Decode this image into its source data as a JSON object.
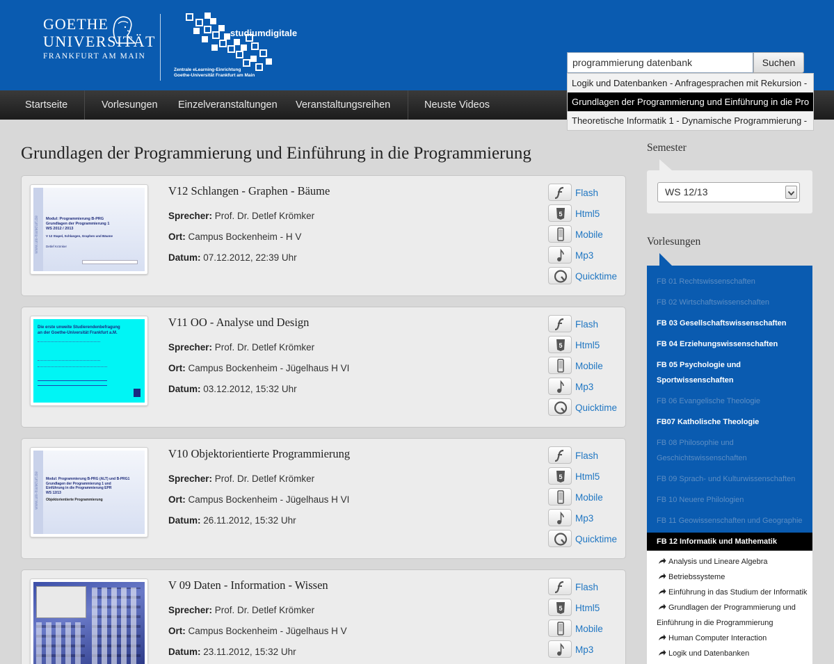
{
  "header": {
    "goethe_line1": "GOETHE",
    "goethe_line2": "UNIVERSITÄT",
    "goethe_line3": "FRANKFURT AM MAIN",
    "studium_title": "studiumdigitale",
    "studium_sub1": "Zentrale eLearning-Einrichtung",
    "studium_sub2": "Goethe-Universität Frankfurt am Main"
  },
  "search": {
    "value": "programmierung datenbank",
    "button_label": "Suchen",
    "suggestions": [
      "Logik und Datenbanken - Anfragesprachen mit Rekursion -",
      "Grundlagen der Programmierung und Einführung in die Pro",
      "Theoretische Informatik 1 - Dynamische Programmierung -"
    ],
    "active_index": 1
  },
  "nav": [
    "Startseite",
    "Vorlesungen",
    "Einzelveranstaltungen",
    "Veranstaltungsreihen",
    "Neuste Videos"
  ],
  "main": {
    "title": "Grundlagen der Programmierung und Einführung in die Programmierung",
    "speaker_label": "Sprecher:",
    "place_label": "Ort:",
    "date_label": "Datum:",
    "formats": [
      "Flash",
      "Html5",
      "Mobile",
      "Mp3",
      "Quicktime"
    ],
    "lectures": [
      {
        "title": "V12 Schlangen - Graphen - Bäume",
        "speaker": "Prof. Dr. Detlef Krömker",
        "place": "Campus Bockenheim - H V",
        "date": "07.12.2012, 22:39 Uhr"
      },
      {
        "title": "V11 OO - Analyse und Design",
        "speaker": "Prof. Dr. Detlef Krömker",
        "place": "Campus Bockenheim - Jügelhaus H VI",
        "date": "03.12.2012, 15:32 Uhr"
      },
      {
        "title": "V10 Objektorientierte Programmierung",
        "speaker": "Prof. Dr. Detlef Krömker",
        "place": "Campus Bockenheim - Jügelhaus H VI",
        "date": "26.11.2012, 15:32 Uhr"
      },
      {
        "title": "V 09 Daten - Information - Wissen",
        "speaker": "Prof. Dr. Detlef Krömker",
        "place": "Campus Bockenheim - Jügelhaus H V",
        "date": "23.11.2012, 15:32 Uhr"
      }
    ],
    "thumbs": {
      "t1_l1": "Modul: Programmierung B-PRG",
      "t1_l2": "Grundlagen der Programmierung 1",
      "t1_l3": "WS 2012 / 2013",
      "t1_l4": "V 12 Stapel, Schlangen, Graphen und Bäume",
      "t1_l5": "Detlef Krömker",
      "t2_l1": "Die erste unweite Studierendenbefragung",
      "t2_l2": "an der Goethe-Universität Frankfurt a.M.",
      "t3_l1": "Modul: Programmierung B-PRG (ALT) und B-PRG1",
      "t3_l2": "Grundlagen der Programmierung 1 und",
      "t3_l3": "Einführung in die Programmierung EPR",
      "t3_l4": "WS 12/13",
      "t3_l5": "Objektorientierte Programmierung",
      "side_text": "www.uni-frankfurt.de"
    }
  },
  "sidebar": {
    "semester_heading": "Semester",
    "semester_value": "WS 12/13",
    "lectures_heading": "Vorlesungen",
    "faculties": [
      {
        "label": "FB 01 Rechtswissenschaften",
        "on": false
      },
      {
        "label": "FB 02 Wirtschaftswissenschaften",
        "on": false
      },
      {
        "label": "FB 03 Gesellschaftswissenschaften",
        "on": true
      },
      {
        "label": "FB 04 Erziehungswissenschaften",
        "on": true
      },
      {
        "label": "FB 05 Psychologie und",
        "on": true
      },
      {
        "label": "Sportwissenschaften",
        "on": true
      },
      {
        "label": "FB 06 Evangelische Theologie",
        "on": false
      },
      {
        "label": "FB07 Katholische Theologie",
        "on": true
      },
      {
        "label": "FB 08 Philosophie und",
        "on": false
      },
      {
        "label": "Geschichtswissenschaften",
        "on": false
      },
      {
        "label": "FB 09 Sprach- und Kulturwissenschaften",
        "on": false
      },
      {
        "label": "FB 10 Neuere Philologien",
        "on": false
      },
      {
        "label": "FB 11 Geowissenschaften und Geographie",
        "on": false
      }
    ],
    "active_faculty": "FB 12 Informatik und Mathematik",
    "courses": [
      "Analysis und Lineare Algebra",
      "Betriebssysteme",
      "Einführung in das Studium der Informatik",
      "Grundlagen der Programmierung und",
      "Einführung in die Programmierung",
      "Human Computer Interaction",
      "Logik und Datenbanken"
    ]
  },
  "colors": {
    "brand_blue": "#0a5bb0",
    "link_blue": "#1f76c2",
    "nav_dark": "#1c1c1c"
  }
}
